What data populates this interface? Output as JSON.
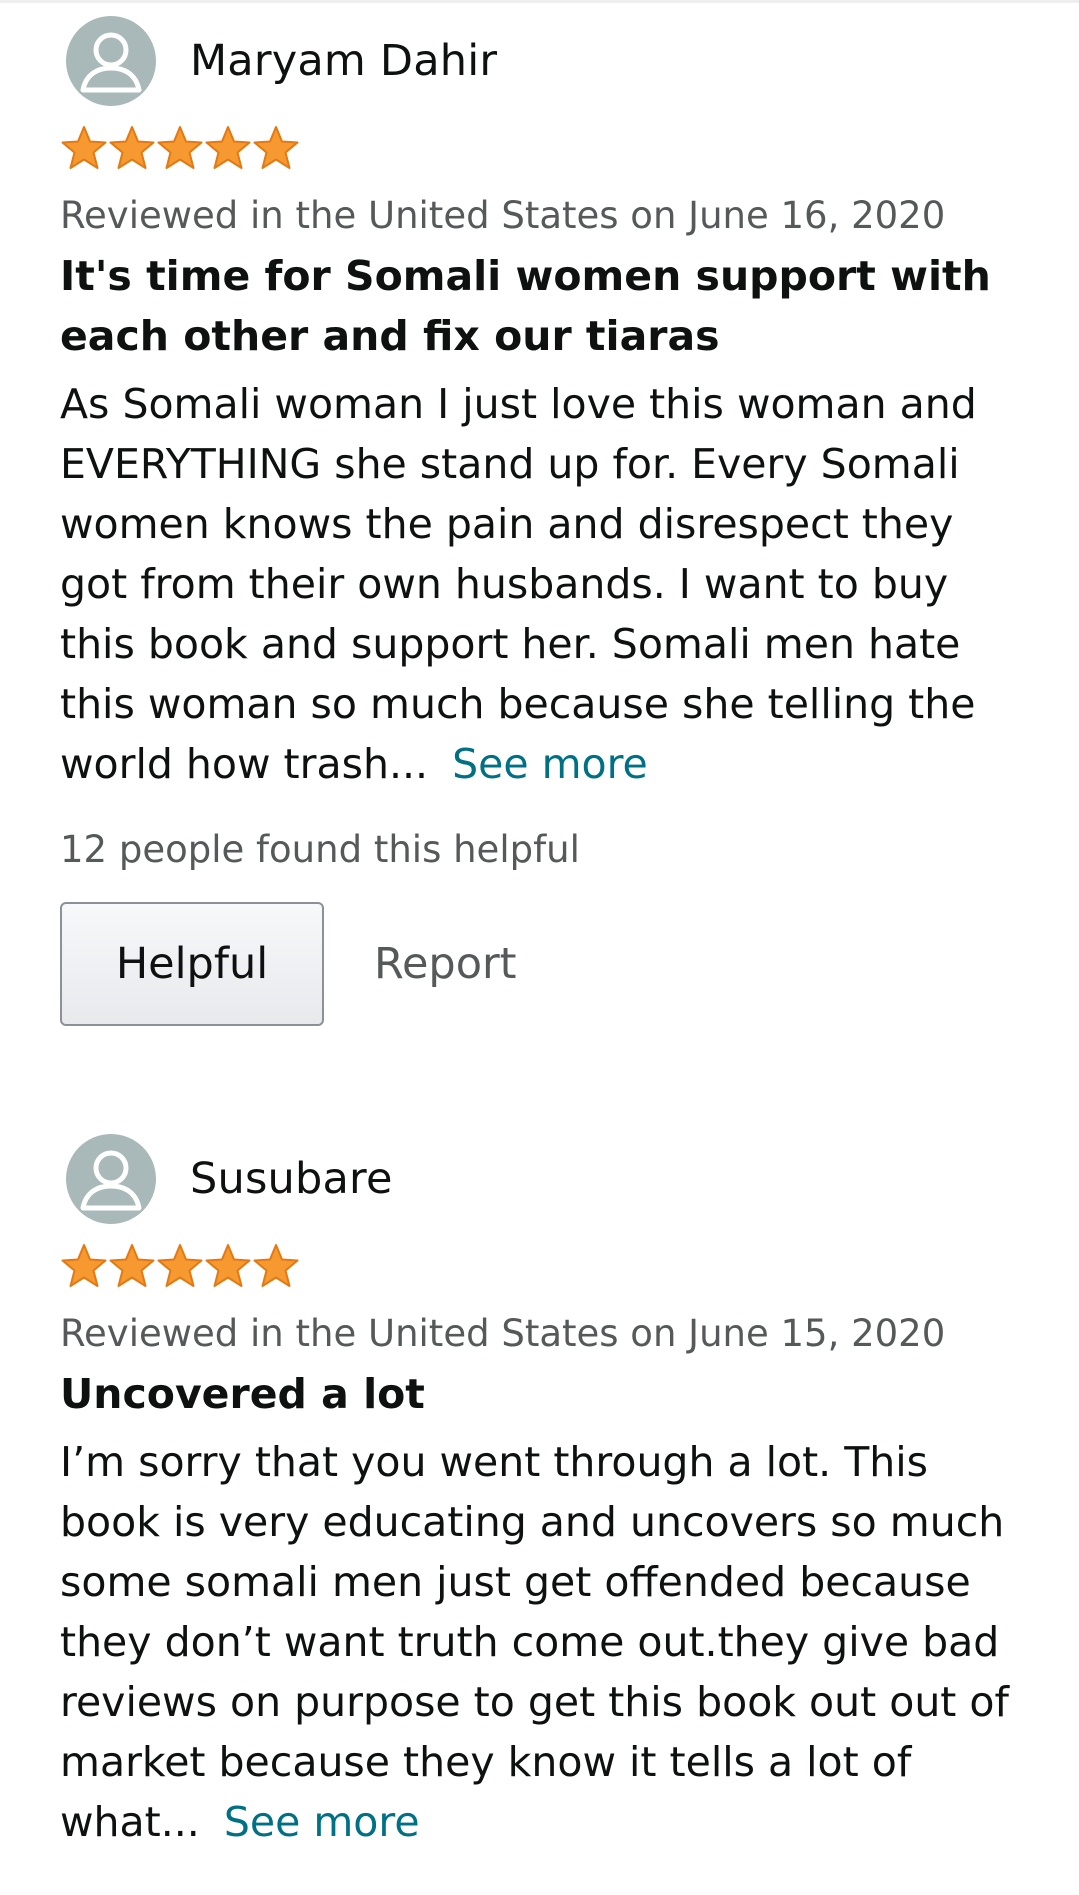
{
  "reviews": [
    {
      "reviewer": "Maryam Dahir",
      "rating": 5,
      "rating_max": 5,
      "date_line": "Reviewed in the United States on June 16, 2020",
      "title_lines": [
        "It's time for Somali women support with",
        "each other and fix our tiaras"
      ],
      "body_lines": [
        "As Somali woman I just love this woman and",
        "EVERYTHING she stand up for. Every Somali",
        "women knows the pain and disrespect they",
        "got from their own husbands. I want to buy",
        "this book and support her. Somali men hate",
        "this woman so much because she telling the",
        "world how trash..."
      ],
      "see_more": "See more",
      "helpful_count": "12 people found this helpful",
      "helpful_button": "Helpful",
      "report_link": "Report"
    },
    {
      "reviewer": "Susubare",
      "rating": 5,
      "rating_max": 5,
      "date_line": "Reviewed in the United States on June 15, 2020",
      "title_lines": [
        "Uncovered a lot"
      ],
      "body_lines": [
        "I’m sorry that you went through a lot. This",
        "book is very educating and uncovers so much",
        "some somali men just get offended because",
        "they don’t want truth come out.they give bad",
        "reviews on purpose to get this book out out of",
        "market because they know it tells a lot of",
        "what..."
      ],
      "see_more": "See more"
    }
  ],
  "icons": {
    "avatar": "default-profile-avatar-icon",
    "star": "star-filled-icon"
  },
  "colors": {
    "star_fill": "#f69931",
    "star_stroke": "#e47911",
    "link": "#007185",
    "muted_text": "#565959",
    "avatar_bg": "#a9b8b8"
  }
}
